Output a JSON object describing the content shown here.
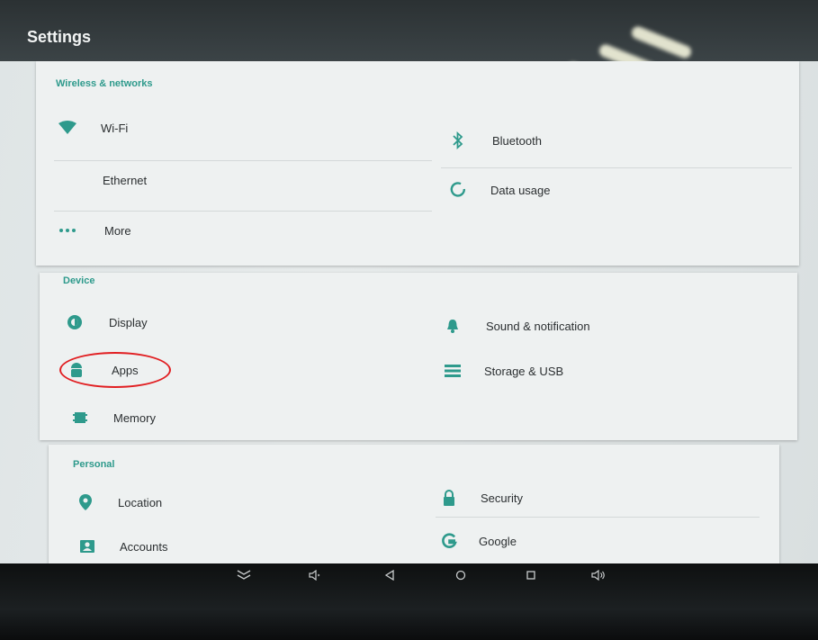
{
  "app": {
    "title": "Settings"
  },
  "sections": {
    "wireless": {
      "header": "Wireless & networks",
      "items": [
        {
          "label": "Wi-Fi",
          "icon": "wifi-icon"
        },
        {
          "label": "Bluetooth",
          "icon": "bluetooth-icon"
        },
        {
          "label": "Ethernet",
          "icon": ""
        },
        {
          "label": "Data usage",
          "icon": "data-usage-icon"
        },
        {
          "label": "More",
          "icon": "more-icon"
        }
      ]
    },
    "device": {
      "header": "Device",
      "items": [
        {
          "label": "Display",
          "icon": "display-icon"
        },
        {
          "label": "Sound & notification",
          "icon": "bell-icon"
        },
        {
          "label": "Apps",
          "icon": "android-icon"
        },
        {
          "label": "Storage & USB",
          "icon": "storage-icon"
        },
        {
          "label": "Memory",
          "icon": "memory-icon"
        }
      ]
    },
    "personal": {
      "header": "Personal",
      "items": [
        {
          "label": "Location",
          "icon": "location-pin-icon"
        },
        {
          "label": "Security",
          "icon": "lock-icon"
        },
        {
          "label": "Accounts",
          "icon": "account-icon"
        },
        {
          "label": "Google",
          "icon": "google-icon"
        }
      ]
    }
  },
  "navigation_bar": [
    "hide-keyboard-icon",
    "volume-down-icon",
    "back-icon",
    "home-icon",
    "recents-icon",
    "volume-up-icon"
  ],
  "colors": {
    "accent": "#2e9a8c",
    "annotation": "#e11f22",
    "appbar": "#353c3f"
  }
}
